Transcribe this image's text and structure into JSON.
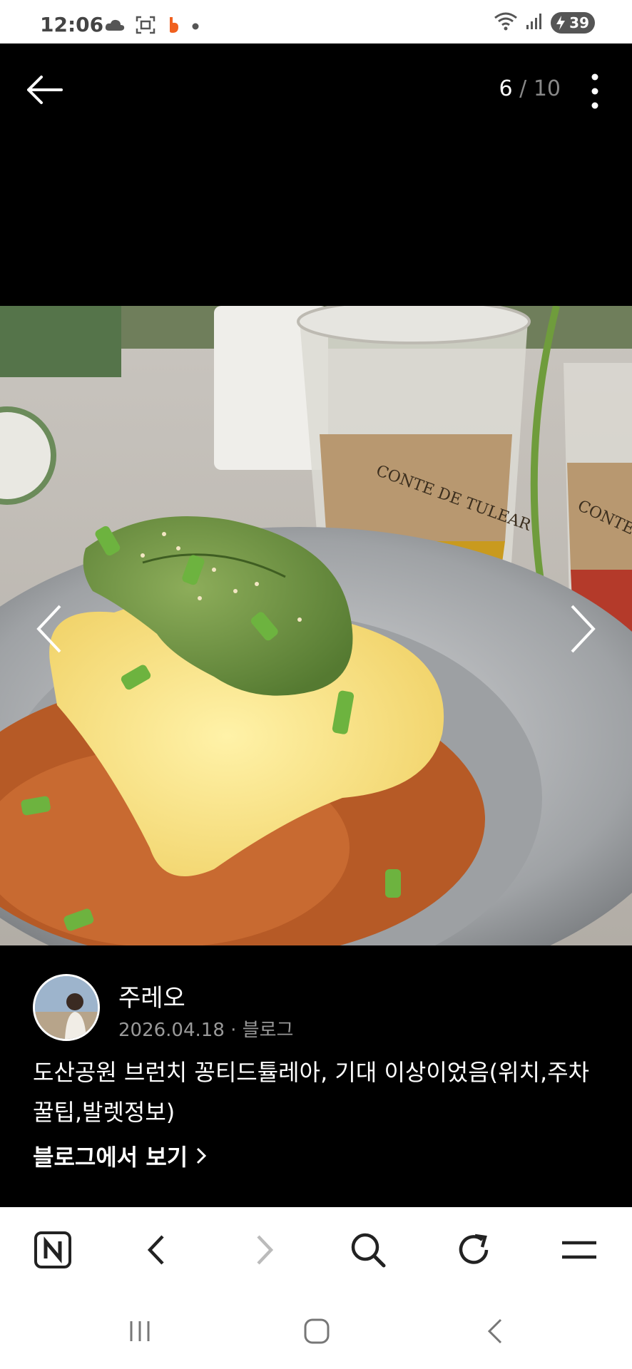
{
  "status_bar": {
    "time": "12:06",
    "battery_level": "39",
    "left_icons": [
      "cloud-icon",
      "screenshot-icon",
      "app-notification-icon",
      "dot-icon"
    ],
    "right_icons": [
      "wifi-icon",
      "signal-icon",
      "battery-icon"
    ]
  },
  "viewer": {
    "current_page": "6",
    "separator": "/",
    "total_pages": "10"
  },
  "post": {
    "author": "주레오",
    "date": "2026.04.18",
    "meta_separator": "·",
    "source": "블로그",
    "title": "도산공원 브런치 꽁티드튤레아, 기대 이상이었음(위치,주차꿀팁,발렛정보)",
    "link_label": "블로그에서 보기"
  },
  "photo": {
    "cup_label_front": "CONTE DE TULEAR",
    "cup_label_back": "CONTE TUL"
  },
  "toolbar": {
    "items": [
      "naver-home-icon",
      "back-icon",
      "forward-icon",
      "search-icon",
      "refresh-icon",
      "menu-icon"
    ]
  },
  "colors": {
    "background": "#000000",
    "meta_gray": "#999999",
    "toolbar_icon": "#222222",
    "toolbar_disabled": "#bbbbbb"
  }
}
